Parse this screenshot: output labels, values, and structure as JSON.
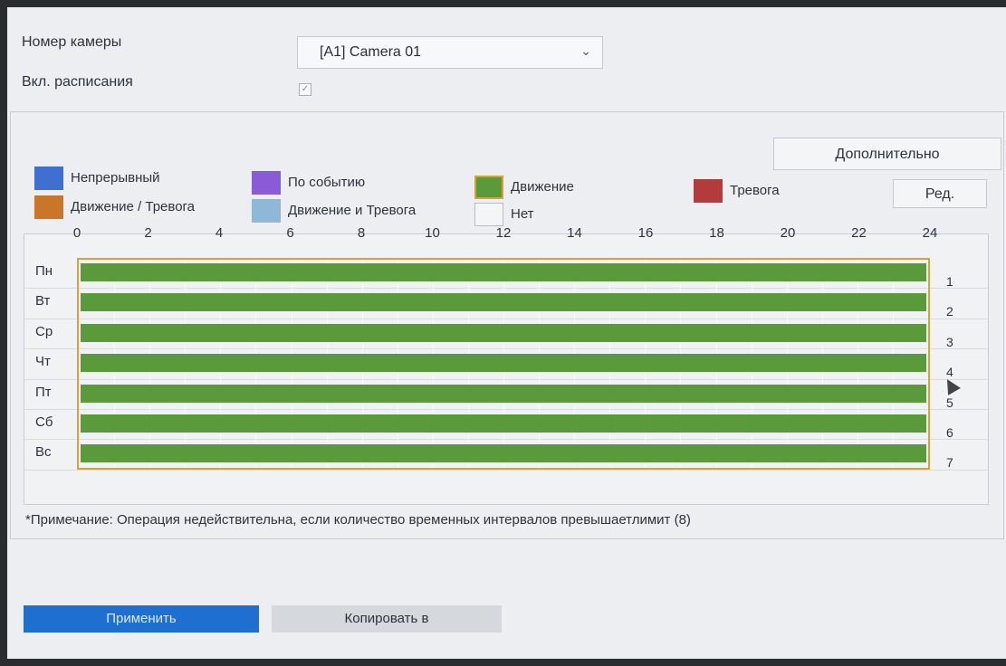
{
  "camera_label": "Номер камеры",
  "camera_value": "[A1] Camera 01",
  "schedule_label": "Вкл. расписания",
  "schedule_enabled": true,
  "advanced_button": "Дополнительно",
  "edit_button": "Ред.",
  "legend": [
    {
      "label": "Непрерывный",
      "color": "#3f6fd0"
    },
    {
      "label": "По событию",
      "color": "#8a5bd6"
    },
    {
      "label": "Движение",
      "color": "#5b9a3a"
    },
    {
      "label": "Тревога",
      "color": "#b23b3b"
    },
    {
      "label": "Движение / Тревога",
      "color": "#c9762b"
    },
    {
      "label": "Движение и Тревога",
      "color": "#8fb7d8"
    },
    {
      "label": "Нет",
      "color": "#f4f5f7"
    }
  ],
  "hours": [
    "0",
    "2",
    "4",
    "6",
    "8",
    "10",
    "12",
    "14",
    "16",
    "18",
    "20",
    "22",
    "24"
  ],
  "days": [
    "Пн",
    "Вт",
    "Ср",
    "Чт",
    "Пт",
    "Сб",
    "Вс"
  ],
  "row_numbers": [
    "1",
    "2",
    "3",
    "4",
    "5",
    "6",
    "7"
  ],
  "schedule_mode": "Движение",
  "note": "*Примечание: Операция недействительна, если количество временных интервалов превышаетлимит (8)",
  "apply_button": "Применить",
  "copy_button": "Копировать в"
}
